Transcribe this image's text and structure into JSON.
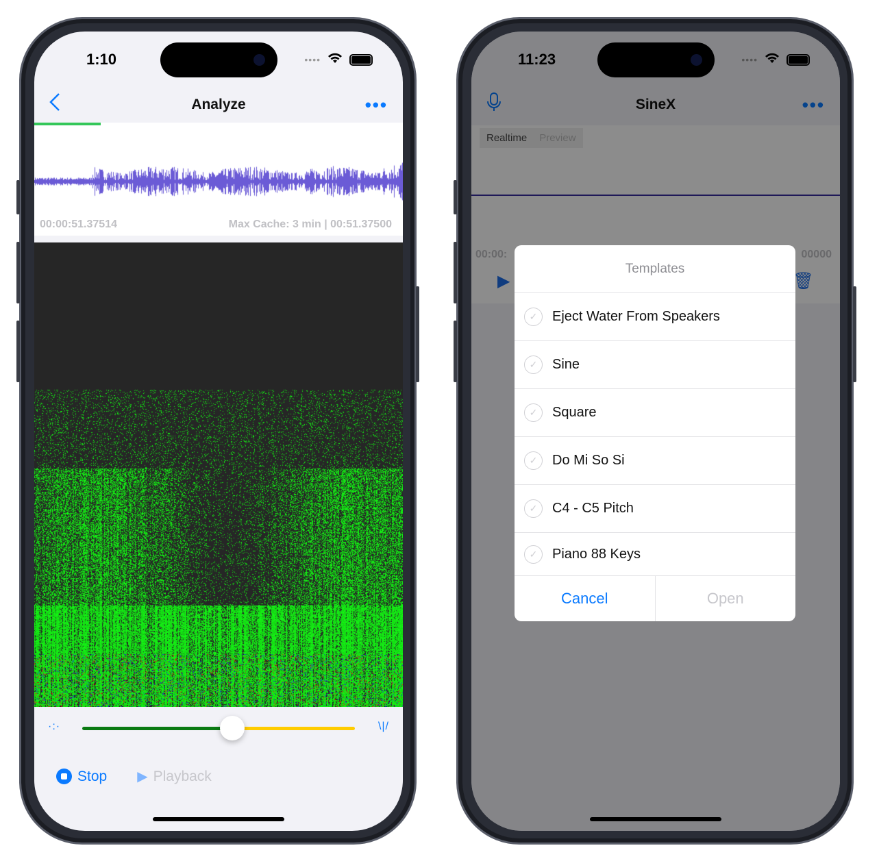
{
  "left": {
    "status": {
      "time": "1:10"
    },
    "nav": {
      "back_icon": "chevron-left-icon",
      "title": "Analyze",
      "more_icon": "ellipsis-icon"
    },
    "progress": 0.18,
    "waveform": {
      "color": "#6b5bd6"
    },
    "time_left": "00:00:51.37514",
    "time_right": "Max Cache: 3 min | 00:51.37500",
    "slider": {
      "value": 0.55,
      "left_color": "#0a7a12",
      "right_color": "#ffcc00",
      "min_icon": "brightness-low-icon",
      "max_icon": "brightness-high-icon"
    },
    "actions": {
      "stop": "Stop",
      "playback": "Playback"
    }
  },
  "right": {
    "status": {
      "time": "11:23"
    },
    "nav": {
      "mic_icon": "microphone-icon",
      "title": "SineX",
      "more_icon": "ellipsis-icon"
    },
    "segments": [
      "Realtime",
      "Preview"
    ],
    "time_left": "00:00:",
    "time_right": "00000",
    "alert": {
      "title": "Templates",
      "options": [
        "Eject Water From Speakers",
        "Sine",
        "Square",
        "Do Mi So Si",
        "C4 - C5 Pitch",
        "Piano 88 Keys"
      ],
      "cancel": "Cancel",
      "open": "Open"
    }
  },
  "colors": {
    "accent": "#0a7aff",
    "spectrogram_green": "#22dd22"
  }
}
